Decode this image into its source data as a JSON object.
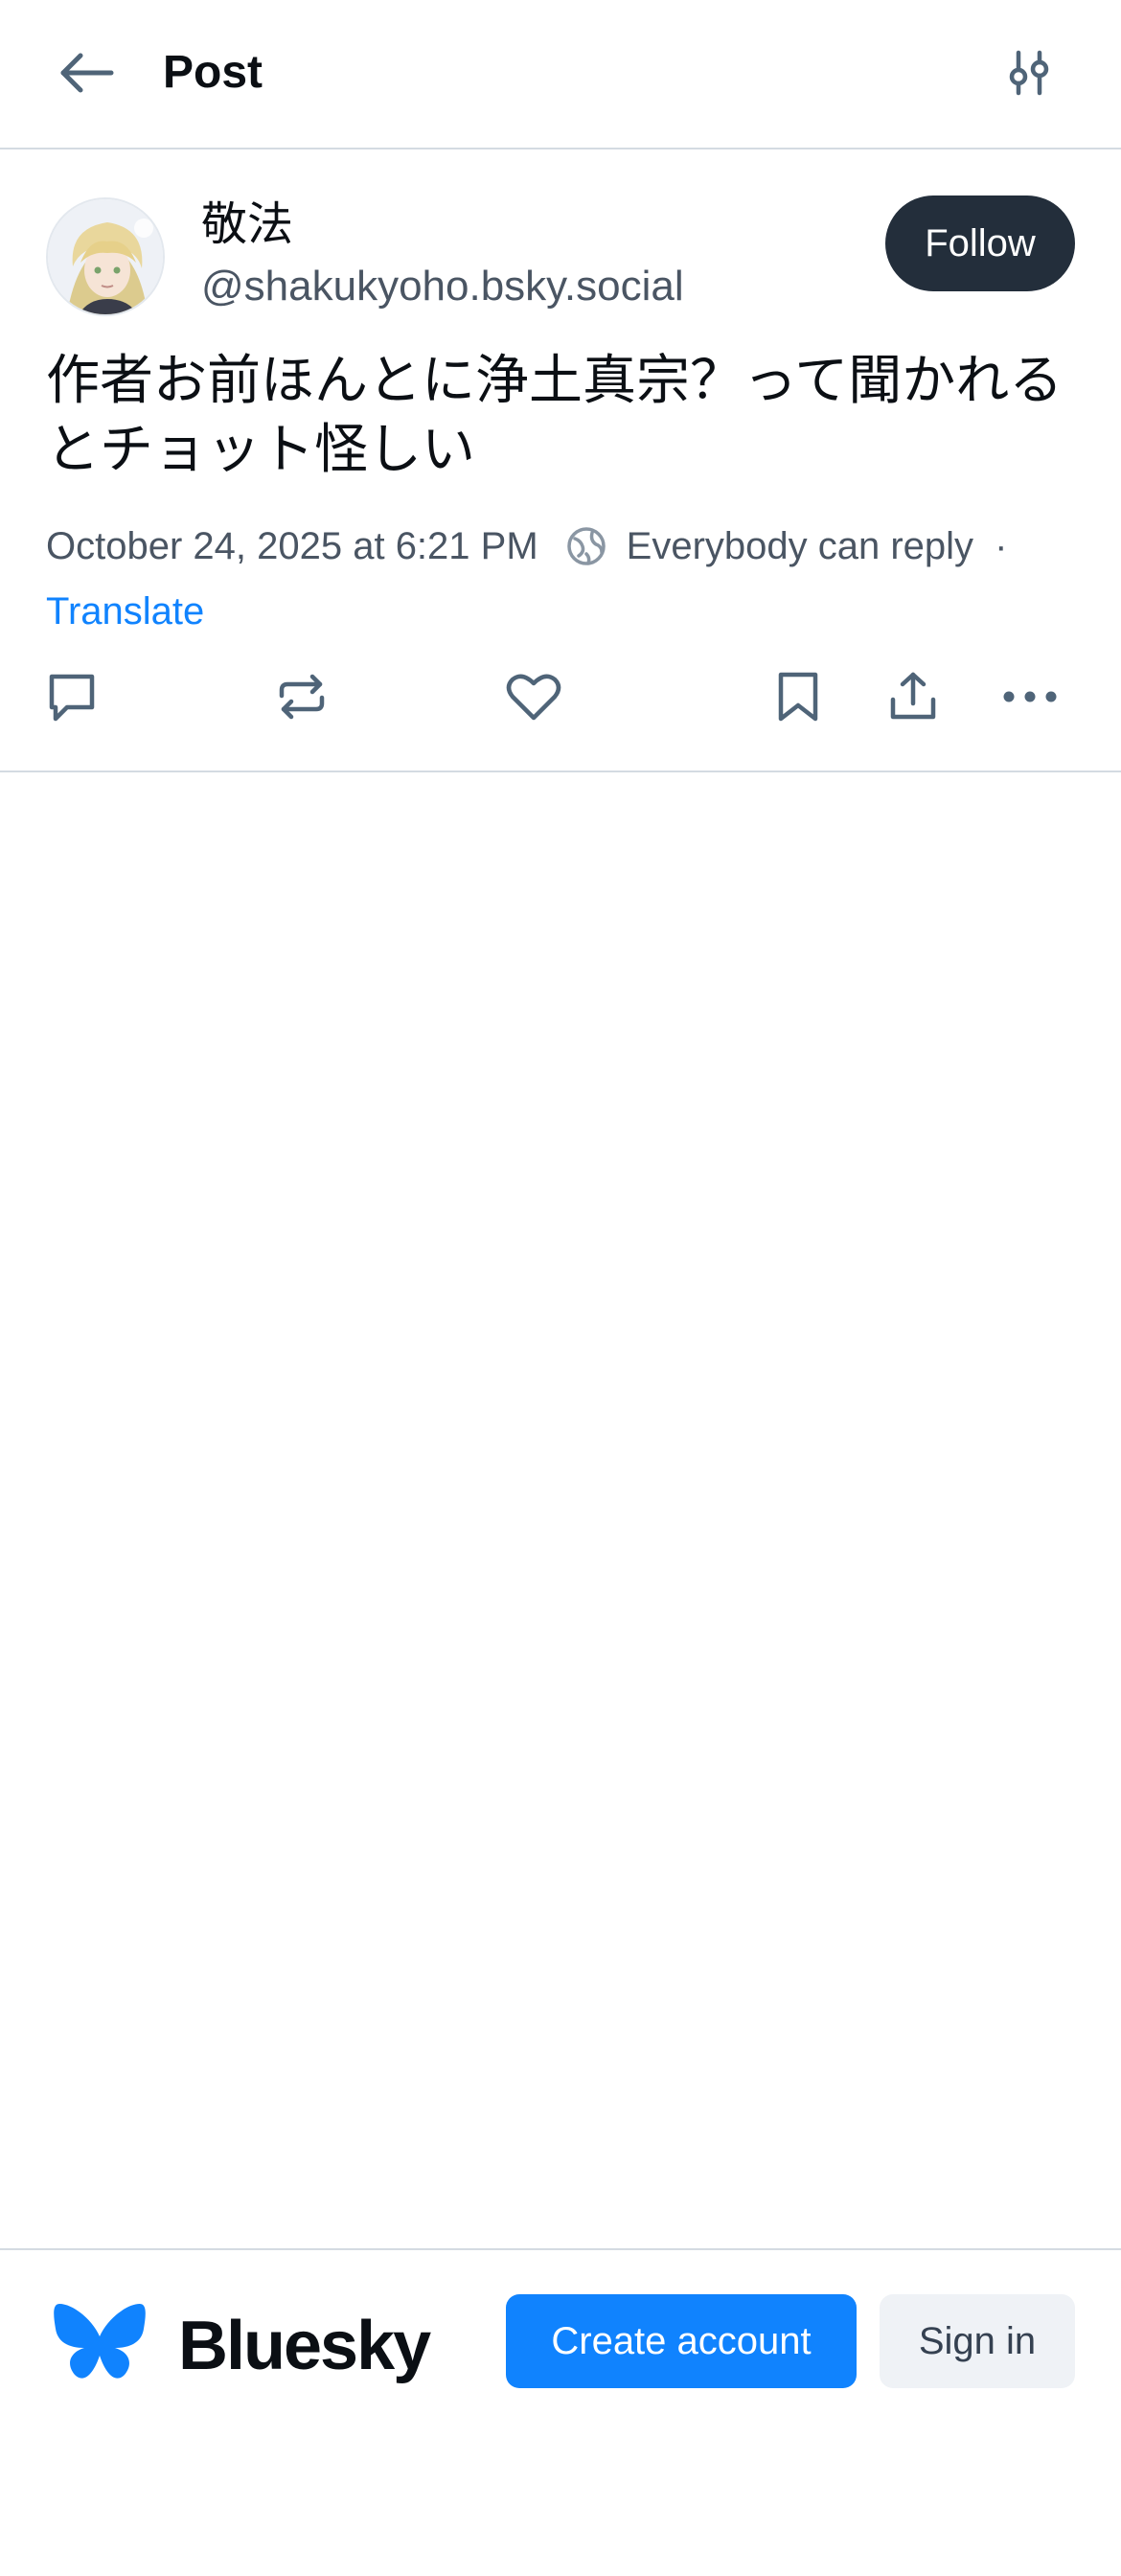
{
  "header": {
    "back_icon": "arrow-left-icon",
    "title": "Post",
    "filter_icon": "sliders-icon"
  },
  "post": {
    "author": {
      "display_name": "敬法",
      "handle": "@shakukyoho.bsky.social",
      "avatar_icon": "avatar-illustration"
    },
    "follow_label": "Follow",
    "text": "作者お前ほんとに浄土真宗？って聞かれるとチョット怪しい",
    "timestamp": "October 24, 2025 at 6:21 PM",
    "reply_setting_icon": "globe-icon",
    "reply_setting": "Everybody can reply",
    "separator": "·",
    "translate_label": "Translate",
    "actions": [
      {
        "name": "reply",
        "icon": "reply-icon"
      },
      {
        "name": "repost",
        "icon": "repost-icon"
      },
      {
        "name": "like",
        "icon": "heart-icon"
      },
      {
        "name": "bookmark",
        "icon": "bookmark-icon"
      },
      {
        "name": "share",
        "icon": "share-icon"
      },
      {
        "name": "more",
        "icon": "ellipsis-icon"
      }
    ]
  },
  "footer": {
    "logo_icon": "bluesky-butterfly-icon",
    "brand": "Bluesky",
    "create_account_label": "Create account",
    "sign_in_label": "Sign in"
  },
  "colors": {
    "accent": "#1083fe",
    "text_primary": "#0b0f14",
    "text_secondary": "#4a5563",
    "follow_bg": "#232e3b",
    "divider": "#d4dbe2",
    "signin_bg": "#eff2f6"
  }
}
